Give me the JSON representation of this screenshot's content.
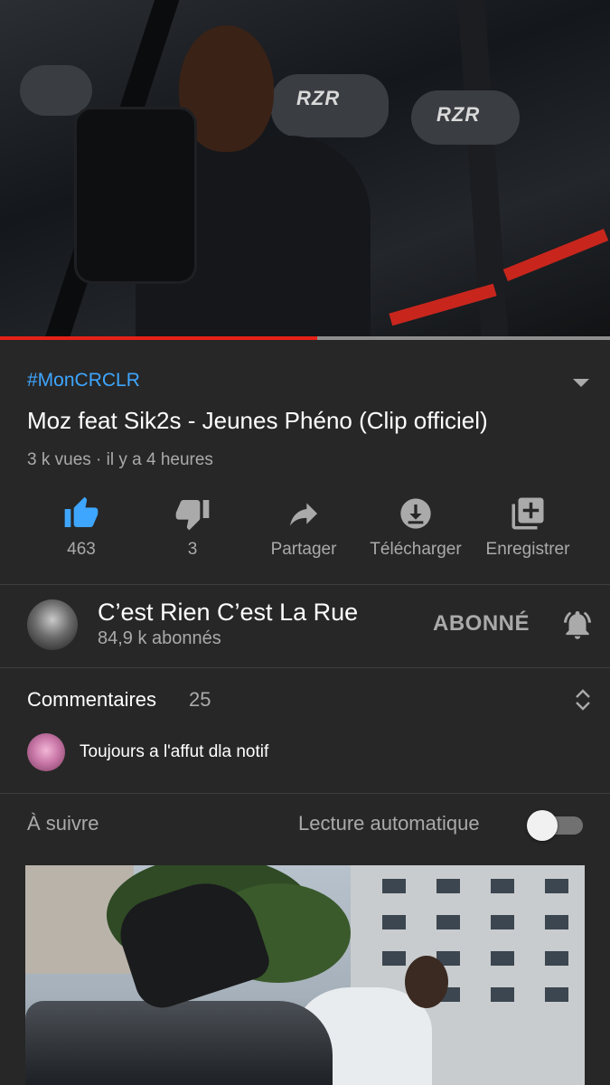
{
  "video": {
    "progress_fraction": 0.52,
    "hashtag": "#MonCRCLR",
    "title": "Moz feat Sik2s - Jeunes Phéno (Clip officiel)",
    "meta": "3 k vues · il y a 4 heures"
  },
  "actions": {
    "like_count": "463",
    "dislike_count": "3",
    "share_label": "Partager",
    "download_label": "Télécharger",
    "save_label": "Enregistrer"
  },
  "channel": {
    "name": "C’est Rien C’est La Rue",
    "subscribers": "84,9 k abonnés",
    "subscribe_label": "ABONNÉ"
  },
  "comments": {
    "title": "Commentaires",
    "count": "25",
    "top_comment": "Toujours a l'affut dla notif"
  },
  "up_next": {
    "label": "À suivre",
    "autoplay_label": "Lecture automatique",
    "autoplay_on": false
  },
  "colors": {
    "background": "#272727",
    "accent_link": "#3ea6ff",
    "progress": "#e62117",
    "secondary_text": "#aaaaaa"
  },
  "icons": [
    "thumb-up-icon",
    "thumb-down-icon",
    "share-icon",
    "download-icon",
    "playlist-add-icon",
    "bell-icon",
    "sort-icon",
    "chevron-down-icon"
  ]
}
